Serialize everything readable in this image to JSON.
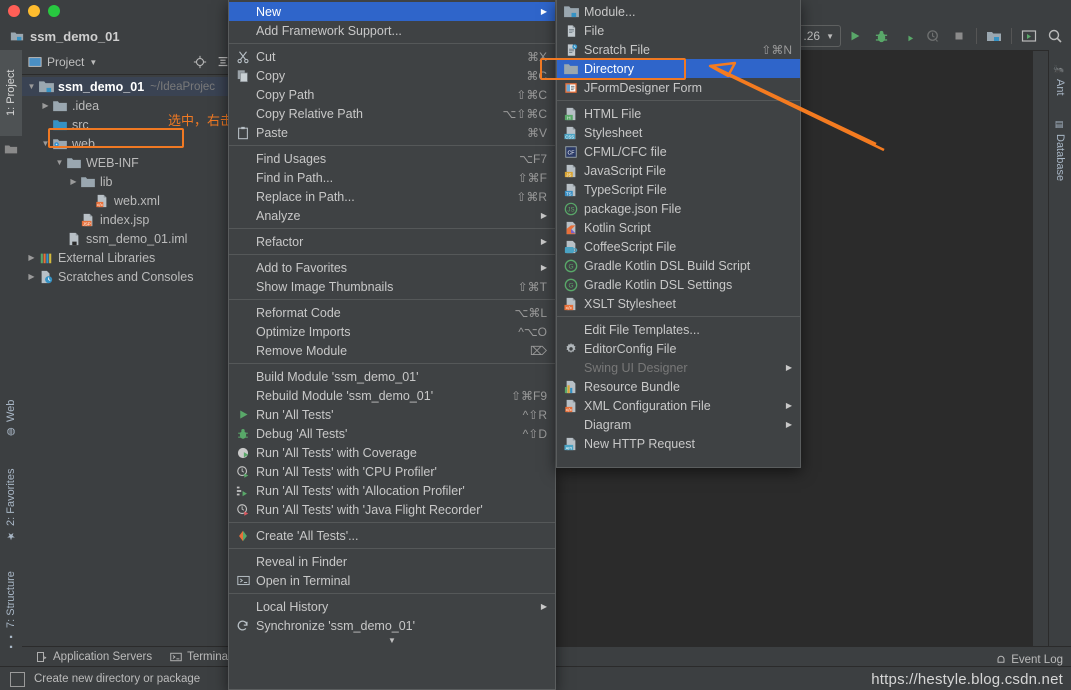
{
  "window": {
    "project_name": "ssm_demo_01"
  },
  "toolbar": {
    "config_value": ".26",
    "buttons": [
      {
        "name": "run-button",
        "label": "Run"
      },
      {
        "name": "debug-button",
        "label": "Debug"
      },
      {
        "name": "run-coverage-button",
        "label": "Run with Coverage"
      },
      {
        "name": "profiler-button",
        "label": "Profiler"
      },
      {
        "name": "stop-button",
        "label": "Stop"
      },
      {
        "name": "project-structure-button",
        "label": "Project Structure"
      },
      {
        "name": "select-opened-file-button",
        "label": "Select Opened File"
      },
      {
        "name": "search-everywhere-button",
        "label": "Search Everywhere"
      }
    ]
  },
  "left_tabs": [
    {
      "label": "1: Project",
      "selected": true
    },
    {
      "label": "Web",
      "selected": false
    },
    {
      "label": "2: Favorites",
      "selected": false
    },
    {
      "label": "7: Structure",
      "selected": false
    }
  ],
  "right_tabs": [
    {
      "label": "Ant"
    },
    {
      "label": "Database"
    }
  ],
  "project_panel": {
    "title": "Project",
    "tree": [
      {
        "label": "ssm_demo_01",
        "sub": "~/IdeaProjec",
        "depth": 0,
        "arrow": "down",
        "icon": "module-icon",
        "selected": true
      },
      {
        "label": ".idea",
        "sub": "",
        "depth": 1,
        "arrow": "right",
        "icon": "folder-icon",
        "selected": false
      },
      {
        "label": "src",
        "sub": "",
        "depth": 1,
        "arrow": "none",
        "icon": "source-folder-icon",
        "selected": false
      },
      {
        "label": "web",
        "sub": "",
        "depth": 1,
        "arrow": "down",
        "icon": "web-folder-icon",
        "selected": false
      },
      {
        "label": "WEB-INF",
        "sub": "",
        "depth": 2,
        "arrow": "down",
        "icon": "folder-icon",
        "selected": false
      },
      {
        "label": "lib",
        "sub": "",
        "depth": 3,
        "arrow": "right",
        "icon": "folder-icon",
        "selected": false
      },
      {
        "label": "web.xml",
        "sub": "",
        "depth": 4,
        "arrow": "none",
        "icon": "xml-file-icon",
        "selected": false
      },
      {
        "label": "index.jsp",
        "sub": "",
        "depth": 3,
        "arrow": "none",
        "icon": "jsp-file-icon",
        "selected": false
      },
      {
        "label": "ssm_demo_01.iml",
        "sub": "",
        "depth": 2,
        "arrow": "none",
        "icon": "iml-file-icon",
        "selected": false
      },
      {
        "label": "External Libraries",
        "sub": "",
        "depth": 0,
        "arrow": "right",
        "icon": "libraries-icon",
        "selected": false
      },
      {
        "label": "Scratches and Consoles",
        "sub": "",
        "depth": 0,
        "arrow": "right",
        "icon": "scratches-icon",
        "selected": false
      }
    ],
    "annotation": "选中，右击"
  },
  "context_menu": {
    "groups": [
      [
        {
          "label": "New",
          "accel": "",
          "icon": "none",
          "submenu": true,
          "highlight": true,
          "disabled": false
        },
        {
          "label": "Add Framework Support...",
          "accel": "",
          "icon": "none",
          "submenu": false,
          "highlight": false,
          "disabled": false
        }
      ],
      [
        {
          "label": "Cut",
          "accel": "⌘X",
          "icon": "cut-icon",
          "submenu": false,
          "highlight": false,
          "disabled": false
        },
        {
          "label": "Copy",
          "accel": "⌘C",
          "icon": "copy-icon",
          "submenu": false,
          "highlight": false,
          "disabled": false
        },
        {
          "label": "Copy Path",
          "accel": "⇧⌘C",
          "icon": "none",
          "submenu": false,
          "highlight": false,
          "disabled": false
        },
        {
          "label": "Copy Relative Path",
          "accel": "⌥⇧⌘C",
          "icon": "none",
          "submenu": false,
          "highlight": false,
          "disabled": false
        },
        {
          "label": "Paste",
          "accel": "⌘V",
          "icon": "paste-icon",
          "submenu": false,
          "highlight": false,
          "disabled": false
        }
      ],
      [
        {
          "label": "Find Usages",
          "accel": "⌥F7",
          "icon": "none",
          "submenu": false,
          "highlight": false,
          "disabled": false
        },
        {
          "label": "Find in Path...",
          "accel": "⇧⌘F",
          "icon": "none",
          "submenu": false,
          "highlight": false,
          "disabled": false
        },
        {
          "label": "Replace in Path...",
          "accel": "⇧⌘R",
          "icon": "none",
          "submenu": false,
          "highlight": false,
          "disabled": false
        },
        {
          "label": "Analyze",
          "accel": "",
          "icon": "none",
          "submenu": true,
          "highlight": false,
          "disabled": false
        }
      ],
      [
        {
          "label": "Refactor",
          "accel": "",
          "icon": "none",
          "submenu": true,
          "highlight": false,
          "disabled": false
        }
      ],
      [
        {
          "label": "Add to Favorites",
          "accel": "",
          "icon": "none",
          "submenu": true,
          "highlight": false,
          "disabled": false
        },
        {
          "label": "Show Image Thumbnails",
          "accel": "⇧⌘T",
          "icon": "none",
          "submenu": false,
          "highlight": false,
          "disabled": false
        }
      ],
      [
        {
          "label": "Reformat Code",
          "accel": "⌥⌘L",
          "icon": "none",
          "submenu": false,
          "highlight": false,
          "disabled": false
        },
        {
          "label": "Optimize Imports",
          "accel": "^⌥O",
          "icon": "none",
          "submenu": false,
          "highlight": false,
          "disabled": false
        },
        {
          "label": "Remove Module",
          "accel": "⌦",
          "icon": "none",
          "submenu": false,
          "highlight": false,
          "disabled": false
        }
      ],
      [
        {
          "label": "Build Module 'ssm_demo_01'",
          "accel": "",
          "icon": "none",
          "submenu": false,
          "highlight": false,
          "disabled": false
        },
        {
          "label": "Rebuild Module 'ssm_demo_01'",
          "accel": "⇧⌘F9",
          "icon": "none",
          "submenu": false,
          "highlight": false,
          "disabled": false
        },
        {
          "label": "Run 'All Tests'",
          "accel": "^⇧R",
          "icon": "run-icon",
          "submenu": false,
          "highlight": false,
          "disabled": false
        },
        {
          "label": "Debug 'All Tests'",
          "accel": "^⇧D",
          "icon": "debug-icon",
          "submenu": false,
          "highlight": false,
          "disabled": false
        },
        {
          "label": "Run 'All Tests' with Coverage",
          "accel": "",
          "icon": "coverage-icon",
          "submenu": false,
          "highlight": false,
          "disabled": false
        },
        {
          "label": "Run 'All Tests' with 'CPU Profiler'",
          "accel": "",
          "icon": "cpu-profiler-icon",
          "submenu": false,
          "highlight": false,
          "disabled": false
        },
        {
          "label": "Run 'All Tests' with 'Allocation Profiler'",
          "accel": "",
          "icon": "allocation-profiler-icon",
          "submenu": false,
          "highlight": false,
          "disabled": false
        },
        {
          "label": "Run 'All Tests' with 'Java Flight Recorder'",
          "accel": "",
          "icon": "flight-recorder-icon",
          "submenu": false,
          "highlight": false,
          "disabled": false
        }
      ],
      [
        {
          "label": "Create 'All Tests'...",
          "accel": "",
          "icon": "create-config-icon",
          "submenu": false,
          "highlight": false,
          "disabled": false
        }
      ],
      [
        {
          "label": "Reveal in Finder",
          "accel": "",
          "icon": "none",
          "submenu": false,
          "highlight": false,
          "disabled": false
        },
        {
          "label": "Open in Terminal",
          "accel": "",
          "icon": "terminal-icon",
          "submenu": false,
          "highlight": false,
          "disabled": false
        }
      ],
      [
        {
          "label": "Local History",
          "accel": "",
          "icon": "none",
          "submenu": true,
          "highlight": false,
          "disabled": false
        },
        {
          "label": "Synchronize 'ssm_demo_01'",
          "accel": "",
          "icon": "sync-icon",
          "submenu": false,
          "highlight": false,
          "disabled": false
        }
      ]
    ]
  },
  "new_submenu": {
    "groups": [
      [
        {
          "label": "Module...",
          "accel": "",
          "icon": "module-icon",
          "submenu": false,
          "highlight": false,
          "disabled": false
        },
        {
          "label": "File",
          "accel": "",
          "icon": "file-icon",
          "submenu": false,
          "highlight": false,
          "disabled": false
        },
        {
          "label": "Scratch File",
          "accel": "⇧⌘N",
          "icon": "scratch-file-icon",
          "submenu": false,
          "highlight": false,
          "disabled": false
        },
        {
          "label": "Directory",
          "accel": "",
          "icon": "folder-icon",
          "submenu": false,
          "highlight": true,
          "disabled": false
        },
        {
          "label": "JFormDesigner Form",
          "accel": "",
          "icon": "jformdesigner-icon",
          "submenu": false,
          "highlight": false,
          "disabled": false
        }
      ],
      [
        {
          "label": "HTML File",
          "accel": "",
          "icon": "html-file-icon",
          "submenu": false,
          "highlight": false,
          "disabled": false
        },
        {
          "label": "Stylesheet",
          "accel": "",
          "icon": "css-file-icon",
          "submenu": false,
          "highlight": false,
          "disabled": false
        },
        {
          "label": "CFML/CFC file",
          "accel": "",
          "icon": "cfml-file-icon",
          "submenu": false,
          "highlight": false,
          "disabled": false
        },
        {
          "label": "JavaScript File",
          "accel": "",
          "icon": "js-file-icon",
          "submenu": false,
          "highlight": false,
          "disabled": false
        },
        {
          "label": "TypeScript File",
          "accel": "",
          "icon": "ts-file-icon",
          "submenu": false,
          "highlight": false,
          "disabled": false
        },
        {
          "label": "package.json File",
          "accel": "",
          "icon": "package-json-icon",
          "submenu": false,
          "highlight": false,
          "disabled": false
        },
        {
          "label": "Kotlin Script",
          "accel": "",
          "icon": "kotlin-script-icon",
          "submenu": false,
          "highlight": false,
          "disabled": false
        },
        {
          "label": "CoffeeScript File",
          "accel": "",
          "icon": "coffeescript-icon",
          "submenu": false,
          "highlight": false,
          "disabled": false
        },
        {
          "label": "Gradle Kotlin DSL Build Script",
          "accel": "",
          "icon": "gradle-icon",
          "submenu": false,
          "highlight": false,
          "disabled": false
        },
        {
          "label": "Gradle Kotlin DSL Settings",
          "accel": "",
          "icon": "gradle-icon",
          "submenu": false,
          "highlight": false,
          "disabled": false
        },
        {
          "label": "XSLT Stylesheet",
          "accel": "",
          "icon": "xslt-file-icon",
          "submenu": false,
          "highlight": false,
          "disabled": false
        }
      ],
      [
        {
          "label": "Edit File Templates...",
          "accel": "",
          "icon": "none",
          "submenu": false,
          "highlight": false,
          "disabled": false
        },
        {
          "label": "EditorConfig File",
          "accel": "",
          "icon": "gear-icon",
          "submenu": false,
          "highlight": false,
          "disabled": false
        },
        {
          "label": "Swing UI Designer",
          "accel": "",
          "icon": "none",
          "submenu": true,
          "highlight": false,
          "disabled": true
        },
        {
          "label": "Resource Bundle",
          "accel": "",
          "icon": "resource-bundle-icon",
          "submenu": false,
          "highlight": false,
          "disabled": false
        },
        {
          "label": "XML Configuration File",
          "accel": "",
          "icon": "xml-file-icon",
          "submenu": true,
          "highlight": false,
          "disabled": false
        },
        {
          "label": "Diagram",
          "accel": "",
          "icon": "none",
          "submenu": true,
          "highlight": false,
          "disabled": false
        },
        {
          "label": "New HTTP Request",
          "accel": "",
          "icon": "http-request-icon",
          "submenu": false,
          "highlight": false,
          "disabled": false
        }
      ]
    ]
  },
  "bottom_bar": {
    "items": [
      {
        "label": "Application Servers",
        "icon": "app-servers-icon"
      },
      {
        "label": "Termina",
        "icon": "terminal-icon"
      }
    ]
  },
  "status_bar": {
    "hint": "Create new directory or package",
    "event_log": "Event Log",
    "watermark": "https://hestyle.blog.csdn.net"
  },
  "colors": {
    "accent_blue": "#2f65ca",
    "annotation_orange": "#f07923",
    "panel_bg": "#3c3f41",
    "editor_bg": "#2b2b2b",
    "menu_bg": "#3f4244"
  }
}
